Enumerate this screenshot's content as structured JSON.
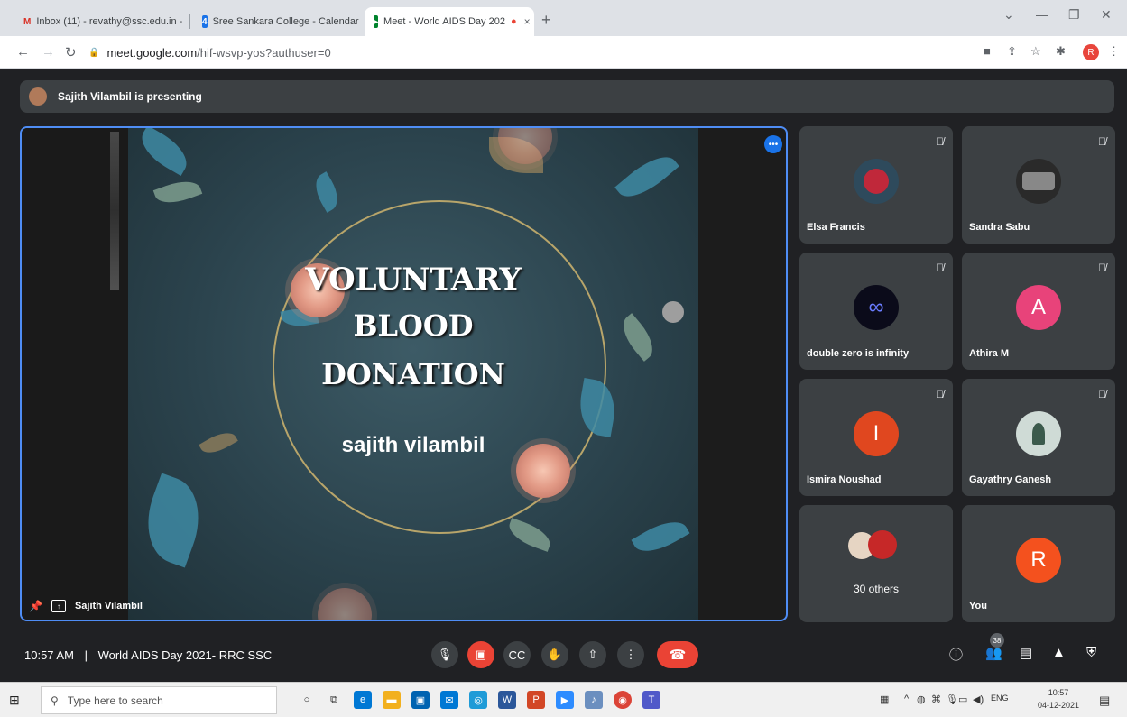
{
  "browser": {
    "tabs": [
      {
        "icon": "gmail-icon",
        "label": "Inbox (11) - revathy@ssc.edu.in -",
        "close": "×"
      },
      {
        "icon": "calendar-icon",
        "label": "Sree Sankara College - Calendar",
        "close": "×"
      },
      {
        "icon": "meet-icon",
        "label": "Meet - World AIDS Day 202",
        "close": "×"
      }
    ],
    "new_tab": "+",
    "window_controls": {
      "minimize": "—",
      "maximize": "❐",
      "close": "✕",
      "dropdown": "⌄"
    },
    "address": {
      "host": "meet.google.com",
      "path": "/hif-wsvp-yos?authuser=0"
    },
    "profile_initial": "R"
  },
  "meet": {
    "presenting_banner": "Sajith Vilambil is presenting",
    "presenter_name": "Sajith Vilambil",
    "slide": {
      "line1": "VOLUNTARY",
      "line2": "BLOOD",
      "line3": "DONATION",
      "author": "sajith vilambil"
    },
    "participants": [
      {
        "name": "Elsa Francis",
        "avatar_color": "#c0283a",
        "initial": ""
      },
      {
        "name": "Sandra Sabu",
        "avatar_color": "#2a2a2a",
        "initial": ""
      },
      {
        "name": "double zero is infinity",
        "avatar_color": "#0b0b1a",
        "initial": ""
      },
      {
        "name": "Athira M",
        "avatar_color": "#e8437a",
        "initial": "A"
      },
      {
        "name": "Ismira Noushad",
        "avatar_color": "#e0471f",
        "initial": "I"
      },
      {
        "name": "Gayathry Ganesh",
        "avatar_color": "#8fa89a",
        "initial": ""
      },
      {
        "name": "You",
        "avatar_color": "#f4511e",
        "initial": "R"
      }
    ],
    "others_label": "30 others",
    "meeting_time": "10:57 AM",
    "meeting_separator": "|",
    "meeting_title": "World AIDS Day 2021- RRC SSC",
    "participant_count": "38"
  },
  "taskbar": {
    "search_placeholder": "Type here to search",
    "lang": "ENG",
    "time": "10:57",
    "date": "04-12-2021"
  }
}
